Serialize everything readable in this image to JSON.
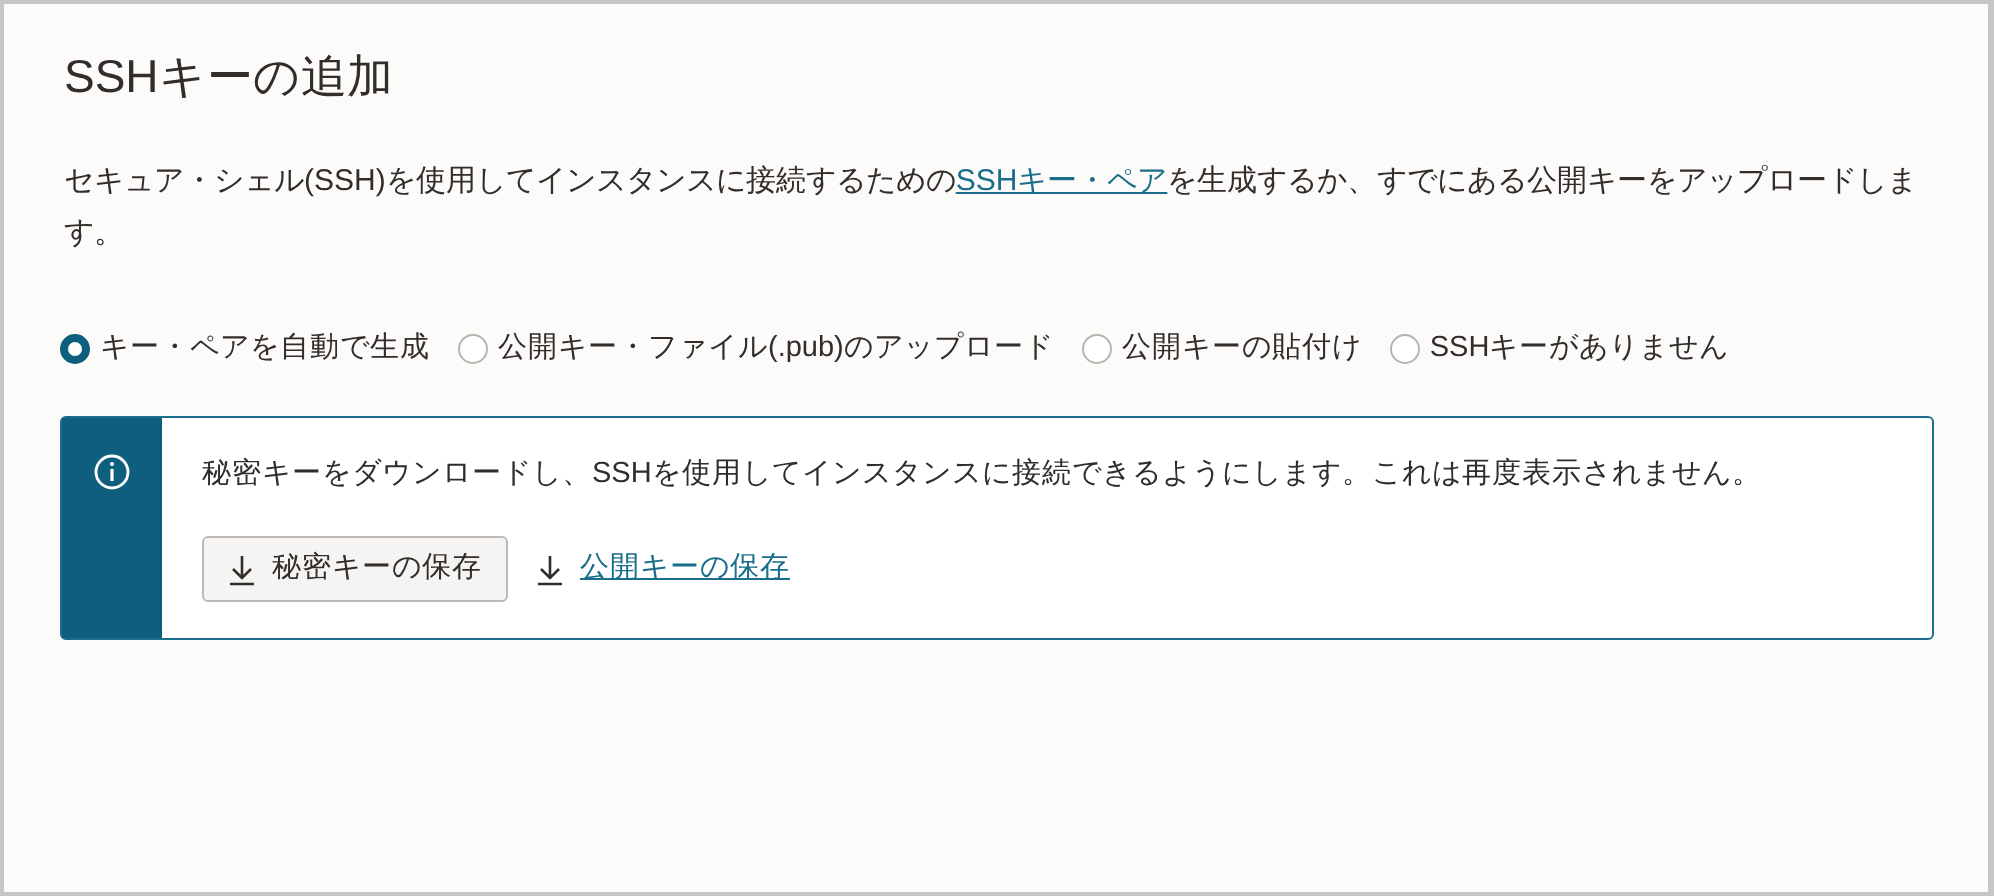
{
  "title": "SSHキーの追加",
  "description": {
    "before": "セキュア・シェル(SSH)を使用してインスタンスに接続するための",
    "link": "SSHキー・ペア",
    "after": "を生成するか、すでにある公開キーをアップロードします。"
  },
  "options": [
    {
      "label": "キー・ペアを自動で生成",
      "selected": true
    },
    {
      "label": "公開キー・ファイル(.pub)のアップロード",
      "selected": false
    },
    {
      "label": "公開キーの貼付け",
      "selected": false
    },
    {
      "label": "SSHキーがありません",
      "selected": false
    }
  ],
  "info": {
    "message": "秘密キーをダウンロードし、SSHを使用してインスタンスに接続できるようにします。これは再度表示されません。",
    "actions": [
      {
        "kind": "button",
        "label": "秘密キーの保存"
      },
      {
        "kind": "link",
        "label": "公開キーの保存"
      }
    ]
  }
}
